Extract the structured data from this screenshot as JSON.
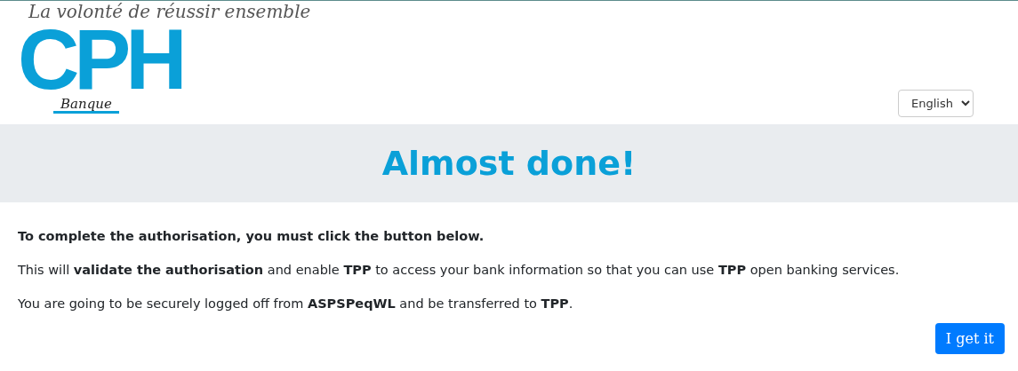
{
  "logo": {
    "tagline": "La volonté de réussir ensemble",
    "mark": "CPH",
    "subtitle": "Banque"
  },
  "language": {
    "value": "English"
  },
  "heading": "Almost done!",
  "paragraphs": [
    {
      "text": "To complete the authorisation, you must click the button below.",
      "bold": true
    },
    {
      "text": "This will **validate the authorisation** and enable **TPP** to access your bank information so that you can use **TPP** open banking services.",
      "bold": false
    },
    {
      "text": "You are going to be securely logged off from **ASPSPeqWL** and be transferred to **TPP**.",
      "bold": false
    }
  ],
  "button": "I get it"
}
